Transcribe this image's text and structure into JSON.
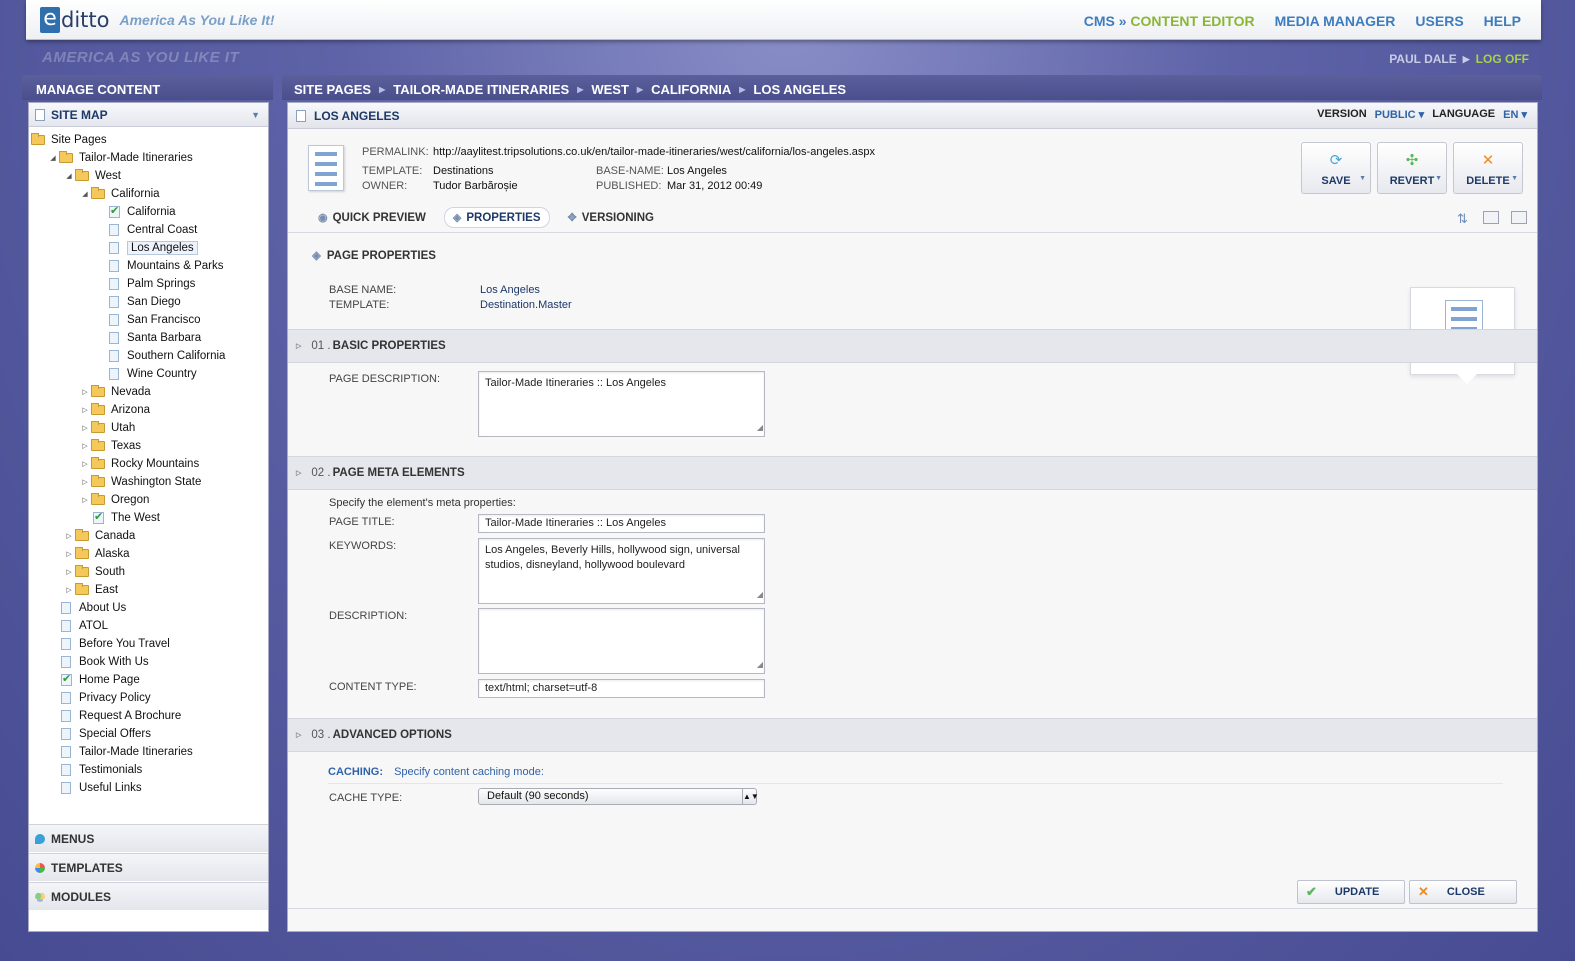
{
  "app": {
    "logo_letter": "e",
    "logo_word": "ditto",
    "tagline": "America As You Like It!",
    "sub_tagline": "AMERICA AS YOU LIKE IT"
  },
  "topnav": {
    "cms_prefix": "CMS »",
    "cms_active": "CONTENT EDITOR",
    "media": "MEDIA MANAGER",
    "users": "USERS",
    "help": "HELP"
  },
  "user": {
    "name": "PAUL DALE",
    "logoff": "LOG OFF"
  },
  "left": {
    "title": "MANAGE CONTENT",
    "sitemap_label": "SITE MAP",
    "tree": [
      {
        "label": "Site Pages",
        "type": "folder",
        "depth": 0,
        "toggle": ""
      },
      {
        "label": "Tailor-Made Itineraries",
        "type": "folder",
        "depth": 1,
        "toggle": "open"
      },
      {
        "label": "West",
        "type": "folder",
        "depth": 2,
        "toggle": "open"
      },
      {
        "label": "California",
        "type": "folder",
        "depth": 3,
        "toggle": "open"
      },
      {
        "label": "California",
        "type": "check",
        "depth": 4,
        "toggle": ""
      },
      {
        "label": "Central Coast",
        "type": "page",
        "depth": 4,
        "toggle": ""
      },
      {
        "label": "Los Angeles",
        "type": "page",
        "depth": 4,
        "toggle": "",
        "selected": true
      },
      {
        "label": "Mountains & Parks",
        "type": "page",
        "depth": 4,
        "toggle": ""
      },
      {
        "label": "Palm Springs",
        "type": "page",
        "depth": 4,
        "toggle": ""
      },
      {
        "label": "San Diego",
        "type": "page",
        "depth": 4,
        "toggle": ""
      },
      {
        "label": "San Francisco",
        "type": "page",
        "depth": 4,
        "toggle": ""
      },
      {
        "label": "Santa Barbara",
        "type": "page",
        "depth": 4,
        "toggle": ""
      },
      {
        "label": "Southern California",
        "type": "page",
        "depth": 4,
        "toggle": ""
      },
      {
        "label": "Wine Country",
        "type": "page",
        "depth": 4,
        "toggle": ""
      },
      {
        "label": "Nevada",
        "type": "folder",
        "depth": 3,
        "toggle": "closed"
      },
      {
        "label": "Arizona",
        "type": "folder",
        "depth": 3,
        "toggle": "closed"
      },
      {
        "label": "Utah",
        "type": "folder",
        "depth": 3,
        "toggle": "closed"
      },
      {
        "label": "Texas",
        "type": "folder",
        "depth": 3,
        "toggle": "closed"
      },
      {
        "label": "Rocky Mountains",
        "type": "folder",
        "depth": 3,
        "toggle": "closed"
      },
      {
        "label": "Washington State",
        "type": "folder",
        "depth": 3,
        "toggle": "closed"
      },
      {
        "label": "Oregon",
        "type": "folder",
        "depth": 3,
        "toggle": "closed"
      },
      {
        "label": "The West",
        "type": "check",
        "depth": 3,
        "toggle": ""
      },
      {
        "label": "Canada",
        "type": "folder",
        "depth": 2,
        "toggle": "closed"
      },
      {
        "label": "Alaska",
        "type": "folder",
        "depth": 2,
        "toggle": "closed"
      },
      {
        "label": "South",
        "type": "folder",
        "depth": 2,
        "toggle": "closed"
      },
      {
        "label": "East",
        "type": "folder",
        "depth": 2,
        "toggle": "closed"
      },
      {
        "label": "About Us",
        "type": "page",
        "depth": 1,
        "toggle": ""
      },
      {
        "label": "ATOL",
        "type": "page",
        "depth": 1,
        "toggle": ""
      },
      {
        "label": "Before You Travel",
        "type": "page",
        "depth": 1,
        "toggle": ""
      },
      {
        "label": "Book With Us",
        "type": "page",
        "depth": 1,
        "toggle": ""
      },
      {
        "label": "Home Page",
        "type": "check",
        "depth": 1,
        "toggle": ""
      },
      {
        "label": "Privacy Policy",
        "type": "page",
        "depth": 1,
        "toggle": ""
      },
      {
        "label": "Request A Brochure",
        "type": "page",
        "depth": 1,
        "toggle": ""
      },
      {
        "label": "Special Offers",
        "type": "page",
        "depth": 1,
        "toggle": ""
      },
      {
        "label": "Tailor-Made Itineraries",
        "type": "page",
        "depth": 1,
        "toggle": ""
      },
      {
        "label": "Testimonials",
        "type": "page",
        "depth": 1,
        "toggle": ""
      },
      {
        "label": "Useful Links",
        "type": "page",
        "depth": 1,
        "toggle": ""
      }
    ],
    "accordion": {
      "menus": "MENUS",
      "templates": "TEMPLATES",
      "modules": "MODULES"
    }
  },
  "breadcrumb": [
    "SITE PAGES",
    "TAILOR-MADE ITINERARIES",
    "WEST",
    "CALIFORNIA",
    "LOS ANGELES"
  ],
  "page": {
    "title": "LOS ANGELES",
    "version_label": "VERSION",
    "version_value": "PUBLIC",
    "language_label": "LANGUAGE",
    "language_value": "EN",
    "permalink_label": "PERMALINK:",
    "permalink": "http://aaylitest.tripsolutions.co.uk/en/tailor-made-itineraries/west/california/los-angeles.aspx",
    "template_label": "TEMPLATE:",
    "template": "Destinations",
    "owner_label": "OWNER:",
    "owner": "Tudor Barbăroșie",
    "basename_label": "BASE-NAME:",
    "basename": "Los Angeles",
    "published_label": "PUBLISHED:",
    "published": "Mar 31, 2012 00:49"
  },
  "actions": {
    "save": "SAVE",
    "revert": "REVERT",
    "delete": "DELETE"
  },
  "tabs": {
    "preview": "QUICK PREVIEW",
    "properties": "PROPERTIES",
    "versioning": "VERSIONING"
  },
  "properties": {
    "heading": "PAGE PROPERTIES",
    "base_name_label": "BASE NAME:",
    "base_name": "Los Angeles",
    "template_label": "TEMPLATE:",
    "template": "Destination.Master"
  },
  "sections": {
    "basic": {
      "num": "01 .",
      "title": "BASIC PROPERTIES"
    },
    "meta": {
      "num": "02 .",
      "title": "PAGE META ELEMENTS"
    },
    "advanced": {
      "num": "03 .",
      "title": "ADVANCED OPTIONS"
    }
  },
  "basic": {
    "desc_label": "PAGE DESCRIPTION:",
    "desc_value": "Tailor-Made Itineraries :: Los Angeles"
  },
  "meta": {
    "intro": "Specify the element's meta properties:",
    "title_label": "PAGE TITLE:",
    "title_value": "Tailor-Made Itineraries :: Los Angeles",
    "keywords_label": "KEYWORDS:",
    "keywords_value": "Los Angeles, Beverly Hills, hollywood sign, universal studios, disneyland, hollywood boulevard",
    "description_label": "DESCRIPTION:",
    "description_value": "",
    "content_type_label": "CONTENT TYPE:",
    "content_type_value": "text/html; charset=utf-8"
  },
  "advanced": {
    "caching_key": "CACHING:",
    "caching_value": "Specify content caching mode:",
    "cache_type_label": "CACHE TYPE:",
    "cache_type_value": "Default (90 seconds)"
  },
  "footer": {
    "update": "UPDATE",
    "close": "CLOSE"
  }
}
